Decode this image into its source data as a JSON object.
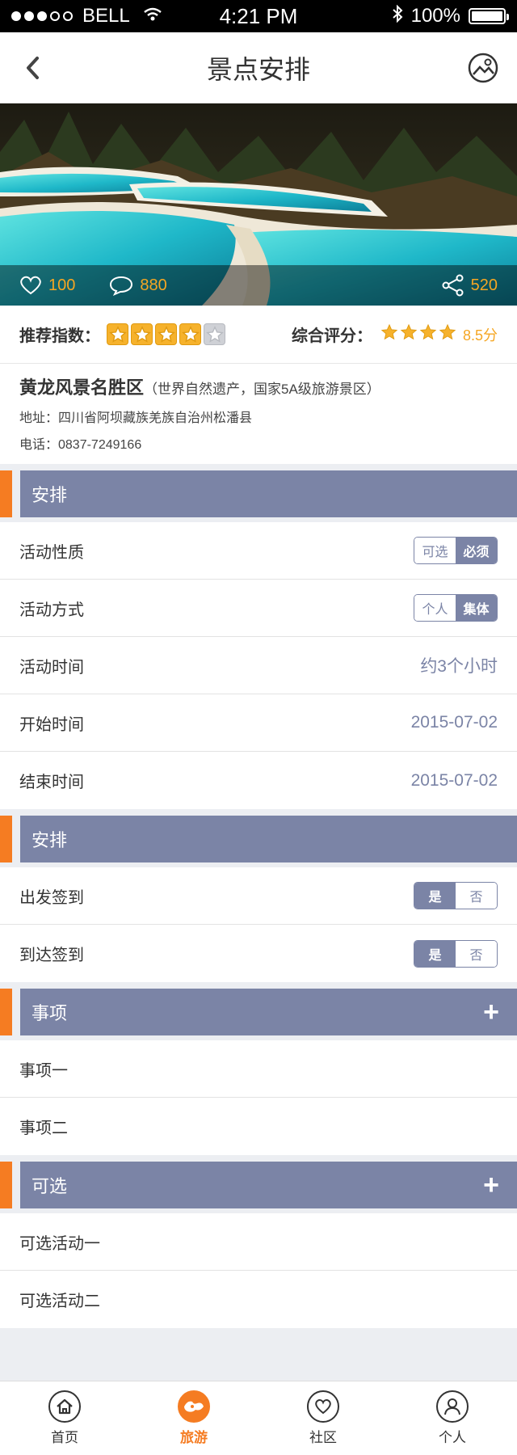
{
  "status_bar": {
    "carrier": "BELL",
    "time": "4:21 PM",
    "battery": "100%"
  },
  "nav": {
    "title": "景点安排"
  },
  "hero": {
    "likes": "100",
    "comments": "880",
    "shares": "520"
  },
  "rating": {
    "recommend_label": "推荐指数：",
    "recommend_stars": 4,
    "score_label": "综合评分：",
    "score_stars": 4,
    "score_value": "8.5分"
  },
  "place": {
    "name": "黄龙风景名胜区",
    "note": "（世界自然遗产，国家5A级旅游景区）",
    "address": "地址：四川省阿坝藏族羌族自治州松潘县",
    "phone": "电话：0837-7249166"
  },
  "section1": {
    "title": "安排",
    "rows": [
      {
        "label": "活动性质",
        "options": [
          "可选",
          "必须"
        ],
        "selected": "必须"
      },
      {
        "label": "活动方式",
        "options": [
          "个人",
          "集体"
        ],
        "selected": "集体"
      },
      {
        "label": "活动时间",
        "value": "约3个小时"
      },
      {
        "label": "开始时间",
        "value": "2015-07-02"
      },
      {
        "label": "结束时间",
        "value": "2015-07-02"
      }
    ]
  },
  "section2": {
    "title": "安排",
    "rows": [
      {
        "label": "出发签到",
        "options": [
          "是",
          "否"
        ],
        "selected": "是"
      },
      {
        "label": "到达签到",
        "options": [
          "是",
          "否"
        ],
        "selected": "是"
      }
    ]
  },
  "section3": {
    "title": "事项",
    "plus": "+",
    "items": [
      "事项一",
      "事项二"
    ]
  },
  "section4": {
    "title": "可选",
    "plus": "+",
    "items": [
      "可选活动一",
      "可选活动二"
    ]
  },
  "tabs": [
    {
      "label": "首页",
      "icon": "home-icon",
      "active": false
    },
    {
      "label": "旅游",
      "icon": "travel-icon",
      "active": true
    },
    {
      "label": "社区",
      "icon": "heart-icon",
      "active": false
    },
    {
      "label": "个人",
      "icon": "user-icon",
      "active": false
    }
  ],
  "colors": {
    "accent": "#f57c22",
    "header": "#7b84a6",
    "star": "#f6b22c"
  }
}
